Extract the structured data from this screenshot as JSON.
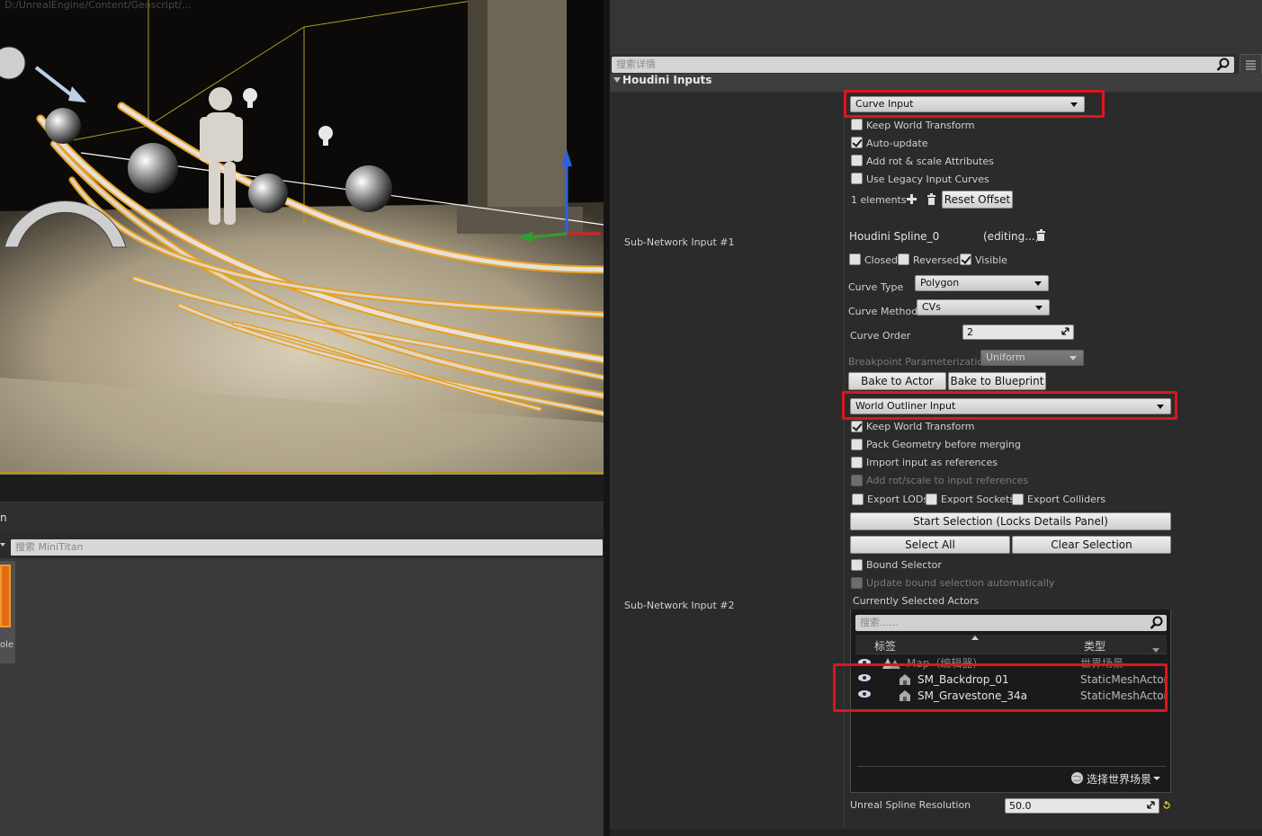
{
  "viewport": {
    "path_text": "D:/UnrealEngine/Content/Geoscript/...",
    "scene": "3d-viewport-spline-roots"
  },
  "content_browser": {
    "title": "n",
    "search_placeholder": "搜索 MiniTitan",
    "asset_label": "ole"
  },
  "details": {
    "search_placeholder": "搜索详情",
    "section_title": "Houdini Inputs",
    "input1": {
      "row_label": "Sub-Network Input #1",
      "type_combo": "Curve Input",
      "keep_world_transform": "Keep World Transform",
      "auto_update": "Auto-update",
      "add_rot_scale": "Add rot & scale Attributes",
      "legacy_curves": "Use Legacy Input Curves",
      "elements": "1 elements",
      "reset_offset": "Reset Offset",
      "spline_name": "Houdini Spline_0",
      "editing": "(editing...)",
      "closed": "Closed",
      "reversed": "Reversed",
      "visible": "Visible",
      "curve_type_label": "Curve Type",
      "curve_type_value": "Polygon",
      "curve_method_label": "Curve Method",
      "curve_method_value": "CVs",
      "curve_order_label": "Curve Order",
      "curve_order_value": "2",
      "breakpoint_label": "Breakpoint Parameterization",
      "breakpoint_value": "Uniform",
      "bake_actor": "Bake to Actor",
      "bake_blueprint": "Bake to Blueprint"
    },
    "input2": {
      "row_label": "Sub-Network Input #2",
      "type_combo": "World Outliner Input",
      "keep_world_transform": "Keep World Transform",
      "pack_geometry": "Pack Geometry before merging",
      "import_refs": "Import input as references",
      "add_rot_scale_refs": "Add rot/scale to input references",
      "export_lods": "Export LODs",
      "export_sockets": "Export Sockets",
      "export_colliders": "Export Colliders",
      "start_selection": "Start Selection (Locks Details Panel)",
      "select_all": "Select All",
      "clear_selection": "Clear Selection",
      "bound_selector": "Bound Selector",
      "update_bound": "Update bound selection automatically",
      "actors_panel": {
        "title": "Currently Selected Actors",
        "search_placeholder": "搜索......",
        "col_label": "标签",
        "col_type": "类型",
        "map_row_name": "Map（编辑器）",
        "map_row_type": "世界场景",
        "rows": [
          {
            "name": "SM_Backdrop_01",
            "type": "StaticMeshActor"
          },
          {
            "name": "SM_Gravestone_34a",
            "type": "StaticMeshActor"
          }
        ],
        "world_picker": "选择世界场景"
      },
      "spline_resolution_label": "Unreal Spline Resolution",
      "spline_resolution_value": "50.0"
    }
  },
  "colors": {
    "highlight_red": "#e0141e",
    "panel_bg": "#2b2b2b",
    "selection_outline": "#e8a020"
  }
}
